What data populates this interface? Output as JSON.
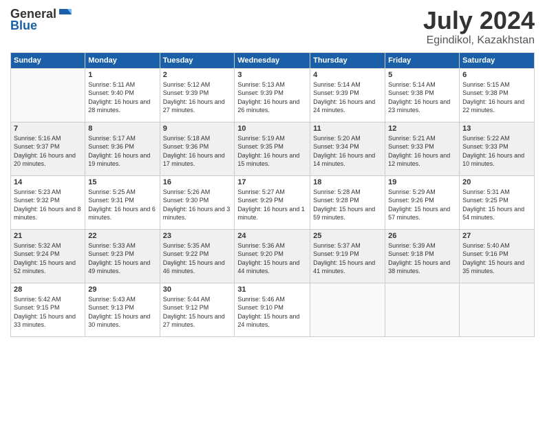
{
  "logo": {
    "general": "General",
    "blue": "Blue"
  },
  "title": {
    "month": "July 2024",
    "location": "Egindikol, Kazakhstan"
  },
  "columns": [
    "Sunday",
    "Monday",
    "Tuesday",
    "Wednesday",
    "Thursday",
    "Friday",
    "Saturday"
  ],
  "weeks": [
    [
      {
        "day": "",
        "sunrise": "",
        "sunset": "",
        "daylight": ""
      },
      {
        "day": "1",
        "sunrise": "Sunrise: 5:11 AM",
        "sunset": "Sunset: 9:40 PM",
        "daylight": "Daylight: 16 hours and 28 minutes."
      },
      {
        "day": "2",
        "sunrise": "Sunrise: 5:12 AM",
        "sunset": "Sunset: 9:39 PM",
        "daylight": "Daylight: 16 hours and 27 minutes."
      },
      {
        "day": "3",
        "sunrise": "Sunrise: 5:13 AM",
        "sunset": "Sunset: 9:39 PM",
        "daylight": "Daylight: 16 hours and 26 minutes."
      },
      {
        "day": "4",
        "sunrise": "Sunrise: 5:14 AM",
        "sunset": "Sunset: 9:39 PM",
        "daylight": "Daylight: 16 hours and 24 minutes."
      },
      {
        "day": "5",
        "sunrise": "Sunrise: 5:14 AM",
        "sunset": "Sunset: 9:38 PM",
        "daylight": "Daylight: 16 hours and 23 minutes."
      },
      {
        "day": "6",
        "sunrise": "Sunrise: 5:15 AM",
        "sunset": "Sunset: 9:38 PM",
        "daylight": "Daylight: 16 hours and 22 minutes."
      }
    ],
    [
      {
        "day": "7",
        "sunrise": "Sunrise: 5:16 AM",
        "sunset": "Sunset: 9:37 PM",
        "daylight": "Daylight: 16 hours and 20 minutes."
      },
      {
        "day": "8",
        "sunrise": "Sunrise: 5:17 AM",
        "sunset": "Sunset: 9:36 PM",
        "daylight": "Daylight: 16 hours and 19 minutes."
      },
      {
        "day": "9",
        "sunrise": "Sunrise: 5:18 AM",
        "sunset": "Sunset: 9:36 PM",
        "daylight": "Daylight: 16 hours and 17 minutes."
      },
      {
        "day": "10",
        "sunrise": "Sunrise: 5:19 AM",
        "sunset": "Sunset: 9:35 PM",
        "daylight": "Daylight: 16 hours and 15 minutes."
      },
      {
        "day": "11",
        "sunrise": "Sunrise: 5:20 AM",
        "sunset": "Sunset: 9:34 PM",
        "daylight": "Daylight: 16 hours and 14 minutes."
      },
      {
        "day": "12",
        "sunrise": "Sunrise: 5:21 AM",
        "sunset": "Sunset: 9:33 PM",
        "daylight": "Daylight: 16 hours and 12 minutes."
      },
      {
        "day": "13",
        "sunrise": "Sunrise: 5:22 AM",
        "sunset": "Sunset: 9:33 PM",
        "daylight": "Daylight: 16 hours and 10 minutes."
      }
    ],
    [
      {
        "day": "14",
        "sunrise": "Sunrise: 5:23 AM",
        "sunset": "Sunset: 9:32 PM",
        "daylight": "Daylight: 16 hours and 8 minutes."
      },
      {
        "day": "15",
        "sunrise": "Sunrise: 5:25 AM",
        "sunset": "Sunset: 9:31 PM",
        "daylight": "Daylight: 16 hours and 6 minutes."
      },
      {
        "day": "16",
        "sunrise": "Sunrise: 5:26 AM",
        "sunset": "Sunset: 9:30 PM",
        "daylight": "Daylight: 16 hours and 3 minutes."
      },
      {
        "day": "17",
        "sunrise": "Sunrise: 5:27 AM",
        "sunset": "Sunset: 9:29 PM",
        "daylight": "Daylight: 16 hours and 1 minute."
      },
      {
        "day": "18",
        "sunrise": "Sunrise: 5:28 AM",
        "sunset": "Sunset: 9:28 PM",
        "daylight": "Daylight: 15 hours and 59 minutes."
      },
      {
        "day": "19",
        "sunrise": "Sunrise: 5:29 AM",
        "sunset": "Sunset: 9:26 PM",
        "daylight": "Daylight: 15 hours and 57 minutes."
      },
      {
        "day": "20",
        "sunrise": "Sunrise: 5:31 AM",
        "sunset": "Sunset: 9:25 PM",
        "daylight": "Daylight: 15 hours and 54 minutes."
      }
    ],
    [
      {
        "day": "21",
        "sunrise": "Sunrise: 5:32 AM",
        "sunset": "Sunset: 9:24 PM",
        "daylight": "Daylight: 15 hours and 52 minutes."
      },
      {
        "day": "22",
        "sunrise": "Sunrise: 5:33 AM",
        "sunset": "Sunset: 9:23 PM",
        "daylight": "Daylight: 15 hours and 49 minutes."
      },
      {
        "day": "23",
        "sunrise": "Sunrise: 5:35 AM",
        "sunset": "Sunset: 9:22 PM",
        "daylight": "Daylight: 15 hours and 46 minutes."
      },
      {
        "day": "24",
        "sunrise": "Sunrise: 5:36 AM",
        "sunset": "Sunset: 9:20 PM",
        "daylight": "Daylight: 15 hours and 44 minutes."
      },
      {
        "day": "25",
        "sunrise": "Sunrise: 5:37 AM",
        "sunset": "Sunset: 9:19 PM",
        "daylight": "Daylight: 15 hours and 41 minutes."
      },
      {
        "day": "26",
        "sunrise": "Sunrise: 5:39 AM",
        "sunset": "Sunset: 9:18 PM",
        "daylight": "Daylight: 15 hours and 38 minutes."
      },
      {
        "day": "27",
        "sunrise": "Sunrise: 5:40 AM",
        "sunset": "Sunset: 9:16 PM",
        "daylight": "Daylight: 15 hours and 35 minutes."
      }
    ],
    [
      {
        "day": "28",
        "sunrise": "Sunrise: 5:42 AM",
        "sunset": "Sunset: 9:15 PM",
        "daylight": "Daylight: 15 hours and 33 minutes."
      },
      {
        "day": "29",
        "sunrise": "Sunrise: 5:43 AM",
        "sunset": "Sunset: 9:13 PM",
        "daylight": "Daylight: 15 hours and 30 minutes."
      },
      {
        "day": "30",
        "sunrise": "Sunrise: 5:44 AM",
        "sunset": "Sunset: 9:12 PM",
        "daylight": "Daylight: 15 hours and 27 minutes."
      },
      {
        "day": "31",
        "sunrise": "Sunrise: 5:46 AM",
        "sunset": "Sunset: 9:10 PM",
        "daylight": "Daylight: 15 hours and 24 minutes."
      },
      {
        "day": "",
        "sunrise": "",
        "sunset": "",
        "daylight": ""
      },
      {
        "day": "",
        "sunrise": "",
        "sunset": "",
        "daylight": ""
      },
      {
        "day": "",
        "sunrise": "",
        "sunset": "",
        "daylight": ""
      }
    ]
  ]
}
